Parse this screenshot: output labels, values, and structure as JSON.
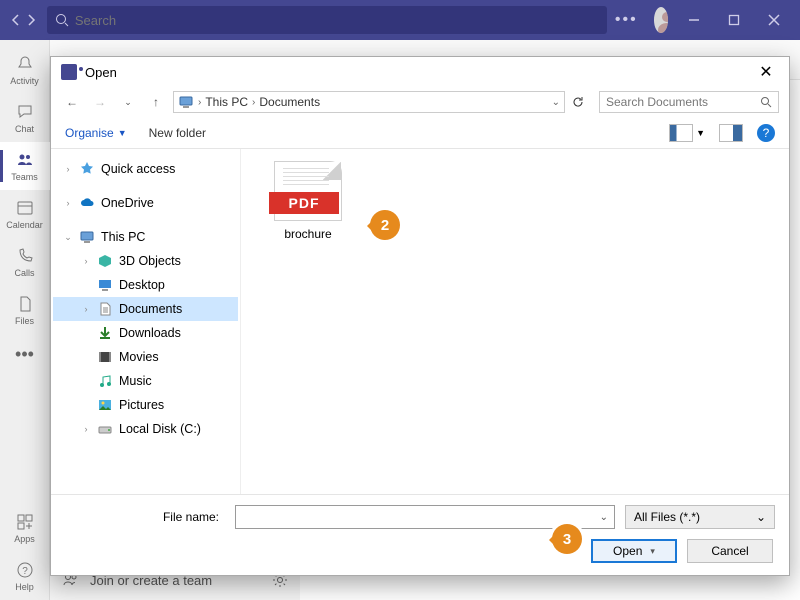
{
  "titlebar": {
    "search_placeholder": "Search"
  },
  "leftrail": {
    "activity": "Activity",
    "chat": "Chat",
    "teams": "Teams",
    "calendar": "Calendar",
    "calls": "Calls",
    "files": "Files",
    "apps": "Apps",
    "help": "Help"
  },
  "joinbar": {
    "label": "Join or create a team"
  },
  "dialog": {
    "title": "Open",
    "breadcrumb": {
      "root": "This PC",
      "folder": "Documents"
    },
    "search_placeholder": "Search Documents",
    "organise": "Organise",
    "new_folder": "New folder",
    "tree": {
      "quick_access": "Quick access",
      "onedrive": "OneDrive",
      "this_pc": "This PC",
      "children": {
        "objects3d": "3D Objects",
        "desktop": "Desktop",
        "documents": "Documents",
        "downloads": "Downloads",
        "movies": "Movies",
        "music": "Music",
        "pictures": "Pictures",
        "local_disk": "Local Disk (C:)"
      }
    },
    "files": {
      "brochure": "brochure",
      "pdf_band": "PDF"
    },
    "footer": {
      "filename_label": "File name:",
      "filter_label": "All Files (*.*)",
      "open": "Open",
      "cancel": "Cancel"
    }
  },
  "steps": {
    "s2": "2",
    "s3": "3"
  }
}
